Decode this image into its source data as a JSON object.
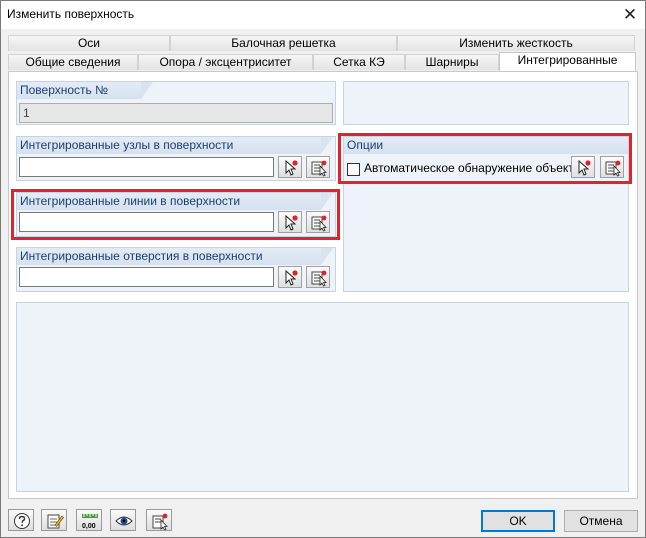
{
  "window": {
    "title": "Изменить поверхность",
    "close_glyph": "✕"
  },
  "tabs_back": [
    {
      "label": "Оси"
    },
    {
      "label": "Балочная решетка"
    },
    {
      "label": "Изменить жесткость"
    }
  ],
  "tabs_front": [
    {
      "label": "Общие сведения"
    },
    {
      "label": "Опора / эксцентриситет"
    },
    {
      "label": "Сетка КЭ"
    },
    {
      "label": "Шарниры"
    },
    {
      "label": "Интегрированные",
      "active": true
    }
  ],
  "surface_number": {
    "label": "Поверхность №",
    "value": "1"
  },
  "integrated_nodes": {
    "label": "Интегрированные узлы в поверхности",
    "value": ""
  },
  "integrated_lines": {
    "label": "Интегрированные линии в поверхности",
    "value": ""
  },
  "integrated_openings": {
    "label": "Интегрированные отверстия в поверхности",
    "value": ""
  },
  "options": {
    "label": "Опции",
    "auto_detect": {
      "label": "Автоматическое обнаружение объекта",
      "checked": false
    }
  },
  "footer": {
    "ok_label": "OK",
    "cancel_label": "Отмена",
    "toolbar_icons": [
      "help-icon",
      "edit-icon",
      "units-icon",
      "view-icon",
      "pick-icon"
    ],
    "units_glyph": "0,00"
  },
  "colors": {
    "highlight": "#e0232d",
    "group_bg": "#eef3fa",
    "group_header": "#d9e3f0",
    "header_text": "#1c3e6e",
    "default_button_border": "#0078d7"
  }
}
